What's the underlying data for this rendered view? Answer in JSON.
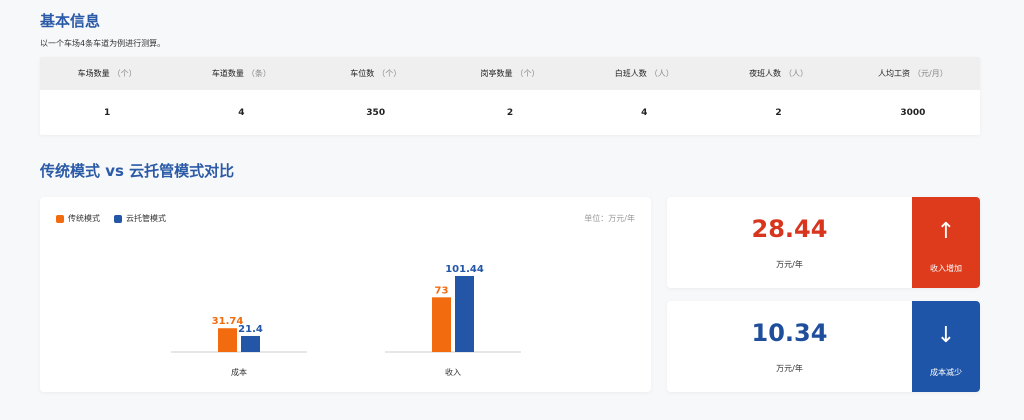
{
  "section1": {
    "title": "基本信息",
    "description": "以一个车场4条车道为例进行测算。"
  },
  "table": {
    "headers": [
      {
        "label": "车场数量",
        "unit": "（个）"
      },
      {
        "label": "车道数量",
        "unit": "（条）"
      },
      {
        "label": "车位数",
        "unit": "（个）"
      },
      {
        "label": "岗亭数量",
        "unit": "（个）"
      },
      {
        "label": "白班人数",
        "unit": "（人）"
      },
      {
        "label": "夜班人数",
        "unit": "（人）"
      },
      {
        "label": "人均工资",
        "unit": "（元/月）"
      }
    ],
    "row": [
      "1",
      "4",
      "350",
      "2",
      "4",
      "2",
      "3000"
    ]
  },
  "section2": {
    "title": "传统模式 vs 云托管模式对比"
  },
  "chart": {
    "legend": [
      "传统模式",
      "云托管模式"
    ],
    "unit_label": "单位：万元/年"
  },
  "chart_data": {
    "type": "bar",
    "categories": [
      "成本",
      "收入"
    ],
    "series": [
      {
        "name": "传统模式",
        "values": [
          31.74,
          73
        ],
        "color": "#f26b0f"
      },
      {
        "name": "云托管模式",
        "values": [
          21.4,
          101.44
        ],
        "color": "#2456a8"
      }
    ],
    "ylim": [
      0,
      101.44
    ],
    "grid": false,
    "legend_position": "top-left"
  },
  "kpis": [
    {
      "value": "28.44",
      "unit": "万元/年",
      "label": "收入增加",
      "arrow": "↑",
      "value_color": "#d7351e",
      "side_color": "#dd3b1c"
    },
    {
      "value": "10.34",
      "unit": "万元/年",
      "label": "成本减少",
      "arrow": "↓",
      "value_color": "#1f4f9c",
      "side_color": "#1f55a8"
    }
  ]
}
